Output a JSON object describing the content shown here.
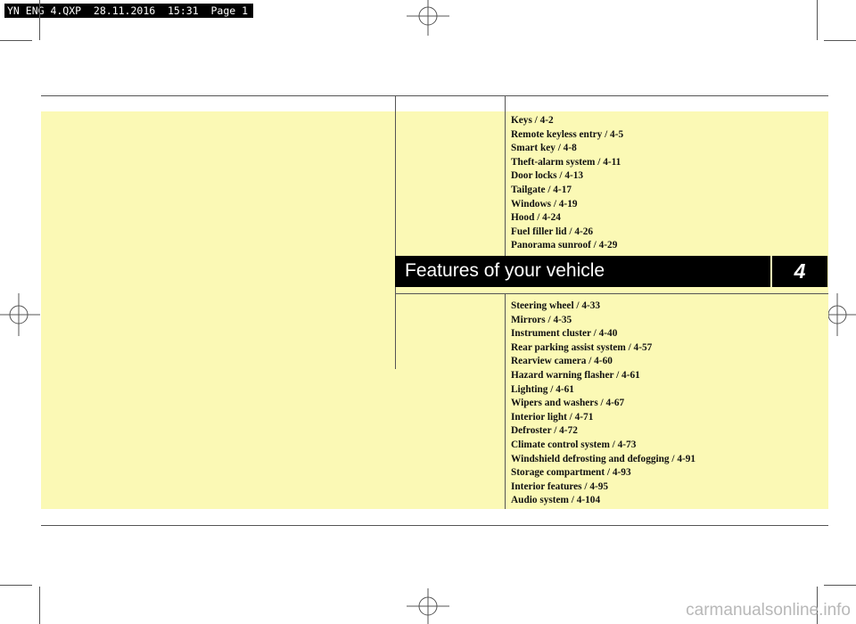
{
  "slug_text": "YN ENG 4.QXP  28.11.2016  15:31  Page 1",
  "chapter": {
    "title": "Features of your vehicle",
    "number": "4"
  },
  "toc_top": [
    "Keys / 4-2",
    "Remote keyless entry / 4-5",
    "Smart key / 4-8",
    "Theft-alarm system / 4-11",
    "Door locks / 4-13",
    "Tailgate / 4-17",
    "Windows / 4-19",
    "Hood / 4-24",
    "Fuel filler lid / 4-26",
    "Panorama sunroof / 4-29"
  ],
  "toc_bottom": [
    "Steering wheel / 4-33",
    "Mirrors / 4-35",
    "Instrument cluster / 4-40",
    "Rear parking assist system / 4-57",
    "Rearview camera / 4-60",
    "Hazard warning flasher / 4-61",
    "Lighting / 4-61",
    "Wipers and washers / 4-67",
    "Interior light / 4-71",
    "Defroster / 4-72",
    "Climate control system / 4-73",
    "Windshield defrosting and defogging / 4-91",
    "Storage compartment / 4-93",
    "Interior features / 4-95",
    "Audio system / 4-104"
  ],
  "watermark": "carmanualsonline.info",
  "colors": {
    "background_panel": "#fbf9b5",
    "banner": "#000000",
    "text": "#111111"
  }
}
